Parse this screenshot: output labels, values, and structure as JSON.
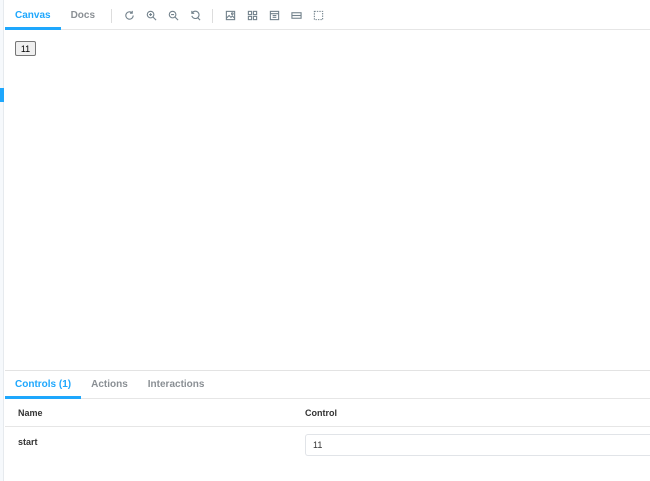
{
  "toolbar": {
    "tabs": [
      {
        "label": "Canvas",
        "active": true
      },
      {
        "label": "Docs",
        "active": false
      }
    ],
    "icons": [
      "reload-icon",
      "zoom-in-icon",
      "zoom-out-icon",
      "reset-zoom-icon",
      "background-icon",
      "grid-icon",
      "viewport-icon",
      "measure-icon",
      "outline-icon"
    ]
  },
  "canvas": {
    "button_label": "11"
  },
  "addons": {
    "tabs": [
      {
        "label": "Controls (1)",
        "active": true
      },
      {
        "label": "Actions",
        "active": false
      },
      {
        "label": "Interactions",
        "active": false
      }
    ],
    "table": {
      "headers": {
        "name": "Name",
        "control": "Control"
      },
      "rows": [
        {
          "name": "start",
          "value": "11"
        }
      ]
    }
  },
  "colors": {
    "accent": "#1ea7fd",
    "tab_inactive": "#8a8f94",
    "border": "#e6e6e6"
  }
}
